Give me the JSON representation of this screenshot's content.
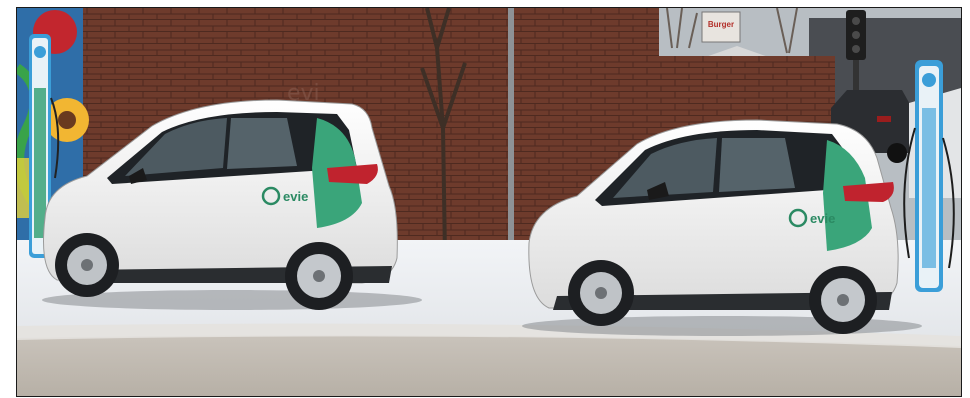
{
  "photo": {
    "brand_text": "evie",
    "wall_text": "evi",
    "sign_text": "Burger",
    "colors": {
      "car_body": "#f3f3f1",
      "car_accent": "#3aa57a",
      "brick": "#6b3a2b",
      "snow": "#eef0f3",
      "charger_blue": "#3b9ed8"
    }
  }
}
